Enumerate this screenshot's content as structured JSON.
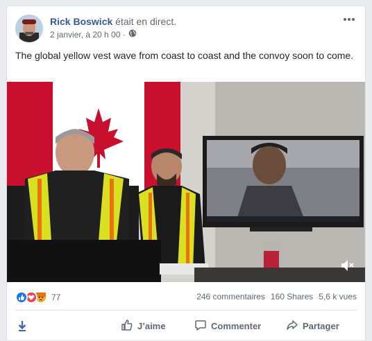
{
  "post": {
    "author": "Rick Boswick",
    "status": " était en direct.",
    "timestamp": "2 janvier, à 20 h 00 ·",
    "text": "The global yellow vest wave from coast to coast and the convoy soon to come."
  },
  "reactions": {
    "count": "77",
    "comments": "246 commentaires",
    "shares": "160 Shares",
    "views": "5,6 k vues"
  },
  "actions": {
    "like": "J’aime",
    "comment": "Commenter",
    "share": "Partager"
  },
  "icons": [
    "globe-icon",
    "more-options-icon",
    "mute-icon",
    "like-reaction-icon",
    "love-reaction-icon",
    "angry-reaction-icon",
    "download-icon",
    "thumbs-up-icon",
    "comment-icon",
    "share-icon"
  ],
  "colors": {
    "author_link": "#365899",
    "like_blue": "#1877f2",
    "love_red": "#f33e58",
    "angry_orange": "#e9710f",
    "vest_yellow": "#d9e021",
    "flag_red": "#c8102e"
  }
}
